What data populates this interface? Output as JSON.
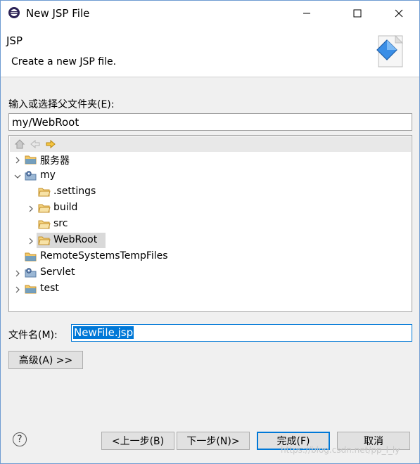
{
  "window": {
    "title": "New JSP File"
  },
  "banner": {
    "title": "JSP",
    "description": "Create a new JSP file."
  },
  "parent_folder": {
    "label": "输入或选择父文件夹(E):",
    "value": "my/WebRoot"
  },
  "tree": {
    "items": [
      {
        "label": "服务器",
        "depth": 0,
        "expander": "collapsed",
        "icon": "folder-icon"
      },
      {
        "label": "my",
        "depth": 0,
        "expander": "expanded",
        "icon": "project-icon"
      },
      {
        "label": ".settings",
        "depth": 1,
        "expander": "none",
        "icon": "folder-icon"
      },
      {
        "label": "build",
        "depth": 1,
        "expander": "collapsed",
        "icon": "folder-icon"
      },
      {
        "label": "src",
        "depth": 1,
        "expander": "none",
        "icon": "folder-icon"
      },
      {
        "label": "WebRoot",
        "depth": 1,
        "expander": "collapsed",
        "icon": "folder-icon",
        "selected": true
      },
      {
        "label": "RemoteSystemsTempFiles",
        "depth": 0,
        "expander": "none",
        "icon": "folder-icon"
      },
      {
        "label": "Servlet",
        "depth": 0,
        "expander": "collapsed",
        "icon": "project-icon"
      },
      {
        "label": "test",
        "depth": 0,
        "expander": "collapsed",
        "icon": "folder-icon"
      }
    ]
  },
  "file_name": {
    "label": "文件名(M):",
    "value": "NewFile.jsp"
  },
  "advanced_button": {
    "label": "高级(A) >>"
  },
  "buttons": {
    "back": "<上一步(B)",
    "next": "下一步(N)>",
    "finish": "完成(F)",
    "cancel": "取消"
  },
  "watermark": "https://blog.csdn.net/pp_l_ly",
  "colors": {
    "selection": "#0078d7",
    "folder": "#e8b84a"
  }
}
